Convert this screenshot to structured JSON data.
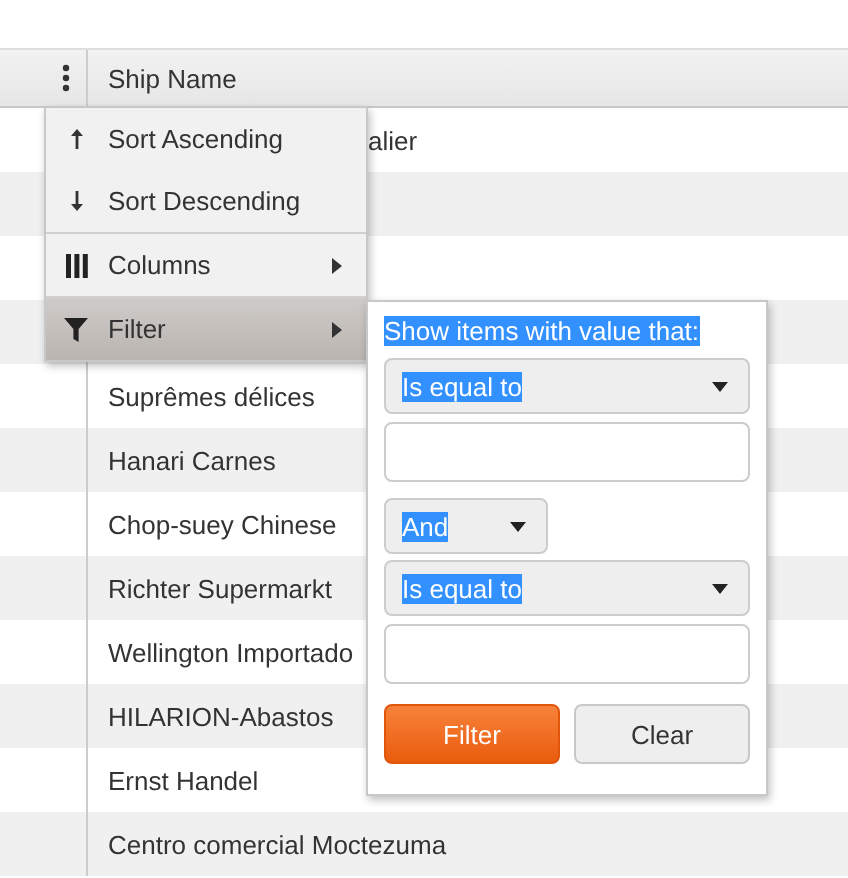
{
  "table": {
    "columns": [
      {
        "label": "Ship Name"
      }
    ],
    "rows": [
      {
        "kind": "clipped",
        "ship_name": "alier"
      },
      {
        "kind": "covered"
      },
      {
        "kind": "covered"
      },
      {
        "kind": "covered"
      },
      {
        "kind": "plain",
        "ship_name": "Suprêmes délices"
      },
      {
        "kind": "plain",
        "ship_name": "Hanari Carnes"
      },
      {
        "kind": "plain",
        "ship_name": "Chop-suey Chinese"
      },
      {
        "kind": "plain",
        "ship_name": "Richter Supermarkt"
      },
      {
        "kind": "plain",
        "ship_name": "Wellington Importado"
      },
      {
        "kind": "plain",
        "ship_name": "HILARION-Abastos"
      },
      {
        "kind": "plain",
        "ship_name": "Ernst Handel"
      },
      {
        "kind": "plain",
        "ship_name": "Centro comercial Moctezuma"
      }
    ]
  },
  "column_menu": {
    "items": [
      {
        "kind": "sort_asc",
        "label": "Sort Ascending",
        "selected": false,
        "submenu": false
      },
      {
        "kind": "sort_desc",
        "label": "Sort Descending",
        "selected": false,
        "submenu": false
      },
      {
        "kind": "columns",
        "label": "Columns",
        "selected": false,
        "submenu": true
      },
      {
        "kind": "filter",
        "label": "Filter",
        "selected": true,
        "submenu": true
      }
    ]
  },
  "filter_popup": {
    "title": "Show items with value that:",
    "operator_1": "Is equal to",
    "logic": "And",
    "operator_2": "Is equal to",
    "buttons": [
      {
        "kind": "primary",
        "label": "Filter"
      },
      {
        "kind": "secondary",
        "label": "Clear"
      }
    ]
  }
}
